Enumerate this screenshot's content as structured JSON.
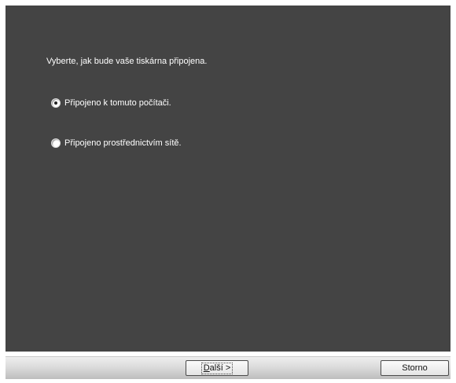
{
  "prompt": "Vyberte, jak bude vaše tiskárna připojena.",
  "options": [
    {
      "label": "Připojeno k tomuto počítači.",
      "selected": true
    },
    {
      "label": "Připojeno prostřednictvím sítě.",
      "selected": false
    }
  ],
  "buttons": {
    "next_prefix": "D",
    "next_rest": "alší >",
    "cancel": "Storno"
  },
  "colors": {
    "panel_bg": "#444444",
    "text": "#ffffff"
  }
}
